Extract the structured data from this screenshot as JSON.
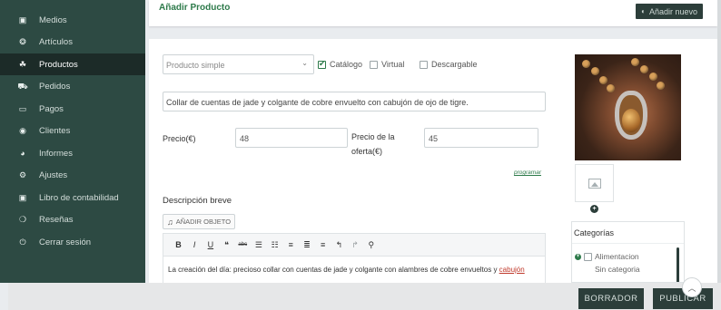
{
  "sidebar": {
    "items": [
      {
        "label": "Medios",
        "icon": "image-icon",
        "glyph": "▣"
      },
      {
        "label": "Artículos",
        "icon": "article-icon",
        "glyph": "❂"
      },
      {
        "label": "Productos",
        "icon": "products-icon",
        "glyph": "☘",
        "active": true
      },
      {
        "label": "Pedidos",
        "icon": "cart-icon",
        "glyph": "⛟"
      },
      {
        "label": "Pagos",
        "icon": "credit-card-icon",
        "glyph": "▭"
      },
      {
        "label": "Clientes",
        "icon": "users-icon",
        "glyph": "◉"
      },
      {
        "label": "Informes",
        "icon": "pie-chart-icon",
        "glyph": "◕"
      },
      {
        "label": "Ajustes",
        "icon": "settings-icon",
        "glyph": "⚙"
      },
      {
        "label": "Libro de contabilidad",
        "icon": "ledger-icon",
        "glyph": "▣"
      },
      {
        "label": "Reseñas",
        "icon": "reviews-icon",
        "glyph": "❍"
      },
      {
        "label": "Cerrar sesión",
        "icon": "power-icon",
        "glyph": "⏻"
      }
    ]
  },
  "header": {
    "title": "Añadir Producto",
    "add_new_label": "Añadir nuevo"
  },
  "form": {
    "product_type": "Producto simple",
    "options": {
      "catalog": {
        "label": "Catálogo",
        "checked": true
      },
      "virtual": {
        "label": "Virtual",
        "checked": false
      },
      "downloadable": {
        "label": "Descargable",
        "checked": false
      }
    },
    "product_title": "Collar de cuentas de jade y colgante de cobre envuelto con cabujón de ojo de tigre.",
    "price_label": "Precio(€)",
    "price_value": "48",
    "sale_price_label_1": "Precio de la",
    "sale_price_label_2": "oferta(€)",
    "sale_price_value": "45",
    "schedule_link": "programar",
    "short_desc_title": "Descripción breve",
    "add_object_label": "AÑADIR OBJETO",
    "editor_text_before": "La creación del día: precioso collar con cuentas de jade y colgante con alambres de cobre envueltos y ",
    "editor_text_spell": "cabujón"
  },
  "toolbar": {
    "buttons": [
      {
        "name": "bold-button",
        "glyph": "B",
        "style": "bold"
      },
      {
        "name": "italic-button",
        "glyph": "I",
        "style": "italic"
      },
      {
        "name": "underline-button",
        "glyph": "U",
        "style": "underline"
      },
      {
        "name": "quote-button",
        "glyph": "❝",
        "style": "normal"
      },
      {
        "name": "strikethrough-button",
        "glyph": "abc",
        "style": "strike"
      },
      {
        "name": "bullet-list-button",
        "glyph": "☰",
        "style": "normal"
      },
      {
        "name": "numbered-list-button",
        "glyph": "☷",
        "style": "normal"
      },
      {
        "name": "align-left-button",
        "glyph": "≡",
        "style": "normal"
      },
      {
        "name": "align-center-button",
        "glyph": "≣",
        "style": "normal"
      },
      {
        "name": "align-right-button",
        "glyph": "≡",
        "style": "normal"
      },
      {
        "name": "undo-button",
        "glyph": "↰",
        "style": "normal"
      },
      {
        "name": "redo-button",
        "glyph": "↱",
        "style": "light"
      },
      {
        "name": "link-button",
        "glyph": "⚲",
        "style": "normal"
      }
    ]
  },
  "categories": {
    "title": "Categorías",
    "items": [
      {
        "label": "Alimentacion",
        "expandable": true
      },
      {
        "label": "Sin categoria",
        "expandable": false
      }
    ]
  },
  "actions": {
    "draft_label": "BORRADOR",
    "publish_label": "PUBLICAR"
  },
  "colors": {
    "sidebar_bg": "#2d4a43",
    "active_bg": "#1c2b28",
    "accent_green": "#2d7a4a",
    "dark_button": "#2c3e3a"
  }
}
